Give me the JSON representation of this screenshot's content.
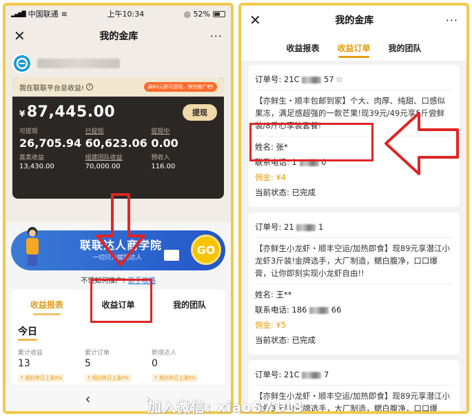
{
  "status_bar": {
    "carrier": "中国联通",
    "time": "上午10:34",
    "battery": "52%",
    "signal": "▂▄▆█",
    "wifi": "≋",
    "clock_icon": "◎"
  },
  "left": {
    "title": "我的金库",
    "close": "✕",
    "more": "···",
    "card": {
      "total_label": "我在联联平台总收益!",
      "help": "?",
      "promo": "满60元即可提现，快快推广吧!",
      "currency": "¥",
      "amount": "87,445.00",
      "withdraw_button": "提现",
      "stats": [
        {
          "label": "可提现",
          "value": "26,705.94"
        },
        {
          "label": "已提现",
          "value": "60,623.06"
        },
        {
          "label": "提现中",
          "value": "0.00"
        },
        {
          "label": "直卖收益",
          "value": "13,430.00"
        },
        {
          "label": "组建团队收益",
          "value": "70,000.00"
        },
        {
          "label": "预收入",
          "value": "116.00"
        }
      ]
    },
    "banner": {
      "title": "联联达人商学院",
      "subtitle": "一切只为赋能达人",
      "go": "GO"
    },
    "help_text": "不懂如何推广? ",
    "help_link": "新手攻略",
    "tabs": [
      "收益报表",
      "收益订单",
      "我的团队"
    ],
    "today": {
      "title": "今日",
      "stats": [
        {
          "label": "累计收益",
          "value": "13",
          "trend": "↑ 相比昨日上涨0%"
        },
        {
          "label": "累计订单",
          "value": "5",
          "trend": "↑ 相比昨日上涨0%"
        },
        {
          "label": "新增达人",
          "value": "0",
          "trend": "↑ 相比昨日上涨0%"
        }
      ]
    },
    "nav": {
      "back": "‹",
      "forward": "›"
    }
  },
  "right": {
    "title": "我的金库",
    "close": "✕",
    "more": "···",
    "tabs": [
      "收益报表",
      "收益订单",
      "我的团队"
    ],
    "orders": [
      {
        "order_label": "订单号: ",
        "order_no_start": "21C",
        "order_no_end": "57",
        "desc": "【亦鲜生・顺丰包邮到家】个大、肉厚、纯甜、口感似果冻，满足感超强的一款芒果!现39元/49元享5斤尝鲜装/8斤心享装套餐!",
        "name_label": "姓名: ",
        "name": "张*",
        "phone_label": "联系电话: ",
        "phone_start": "1",
        "phone_end": "0",
        "commission_label": "佣金: ",
        "commission": "¥4",
        "state_label": "当前状态: ",
        "state": "已完成"
      },
      {
        "order_label": "订单号: ",
        "order_no_start": "21",
        "order_no_end": "1",
        "desc": "【亦鲜生小龙虾・顺丰空运/加热即食】现89元享潜江小龙虾3斤装!金牌选手，大厂制造，鳃白腹净，口口爆膏，让你即刻实现小龙虾自由!!",
        "name_label": "姓名: ",
        "name": "王**",
        "phone_label": "联系电话: ",
        "phone_start": "186",
        "phone_end": "66",
        "commission_label": "佣金: ",
        "commission": "¥5",
        "state_label": "当前状态: ",
        "state": "已完成"
      },
      {
        "order_label": "订单号: ",
        "order_no_start": "21C",
        "order_no_end": "7",
        "desc": "【亦鲜生小龙虾・顺丰空运/加热即食】现89元享潜江小龙虾3斤装!金牌选手，大厂制造，鳃白腹净，口口爆膏，让你即刻实现小龙虾自由!!"
      }
    ]
  },
  "watermark": "加入微信: xiao57113",
  "colors": {
    "accent": "#e39b11",
    "highlight": "#e02424",
    "frame": "#f2c94c"
  }
}
